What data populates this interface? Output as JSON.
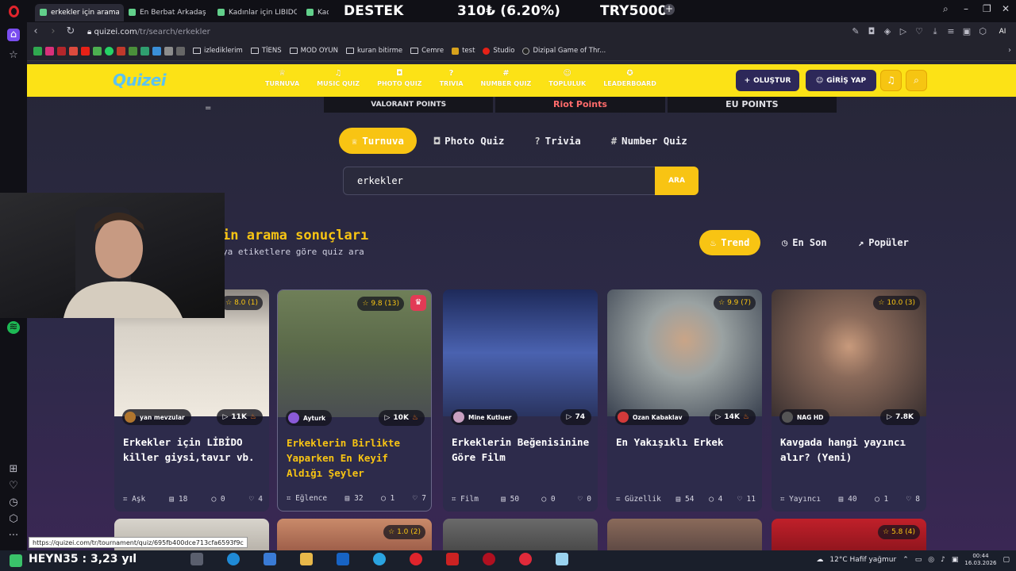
{
  "browser": {
    "tabs": [
      {
        "title": "erkekler için arama sonuç",
        "active": true
      },
      {
        "title": "En Berbat Arkadaş Tipi? -",
        "active": false
      },
      {
        "title": "Kadınlar için LİBİDO killer",
        "active": false
      },
      {
        "title": "Kadınım",
        "active": false
      }
    ],
    "promo_left": "DESTEK",
    "promo_mid": "310₺ (6.20%)",
    "promo_right": "TRY5000",
    "url_host": "quizei.com",
    "url_path": "/tr/search/erkekler",
    "ai_label": "AI",
    "bookmarks": [
      {
        "label": "izlediklerim",
        "type": "folder"
      },
      {
        "label": "TİENS",
        "type": "folder"
      },
      {
        "label": "MOD OYUN",
        "type": "folder"
      },
      {
        "label": "kuran bitirme",
        "type": "folder"
      },
      {
        "label": "Cemre",
        "type": "folder"
      },
      {
        "label": "test",
        "type": "site"
      },
      {
        "label": "Studio",
        "type": "site"
      },
      {
        "label": "Dizipal Game of Thr...",
        "type": "site"
      }
    ],
    "hover_url": "https://quizei.com/tr/tournament/quiz/695fb400dce713cfa6593f9c"
  },
  "site": {
    "logo": "Quizei",
    "menu": [
      {
        "label": "TURNUVA",
        "icon": "trophy-icon",
        "glyph": "♕"
      },
      {
        "label": "MUSIC QUIZ",
        "icon": "music-icon",
        "glyph": "♫"
      },
      {
        "label": "PHOTO QUIZ",
        "icon": "camera-icon",
        "glyph": "◘"
      },
      {
        "label": "TRIVIA",
        "icon": "question-icon",
        "glyph": "?"
      },
      {
        "label": "NUMBER QUIZ",
        "icon": "hash-icon",
        "glyph": "#"
      },
      {
        "label": "TOPLULUK",
        "icon": "users-icon",
        "glyph": "☺"
      },
      {
        "label": "LEADERBOARD",
        "icon": "award-icon",
        "glyph": "✪"
      }
    ],
    "create_label": "OLUŞTUR",
    "login_label": "GİRİŞ YAP",
    "ads": [
      "VALORANT POINTS",
      "Riot Points",
      "EU POINTS"
    ],
    "dash": "="
  },
  "search": {
    "type_tabs": [
      {
        "label": "Turnuva",
        "icon": "trophy-icon",
        "glyph": "♕",
        "active": true
      },
      {
        "label": "Photo Quiz",
        "icon": "camera-icon",
        "glyph": "◘",
        "active": false
      },
      {
        "label": "Trivia",
        "icon": "question-icon",
        "glyph": "?",
        "active": false
      },
      {
        "label": "Number Quiz",
        "icon": "hash-icon",
        "glyph": "#",
        "active": false
      }
    ],
    "query": "erkekler",
    "button_label": "ARA",
    "title_visible": "in arama sonuçları",
    "subtitle_visible": "ya etiketlere göre quiz ara",
    "sort": [
      {
        "label": "Trend",
        "icon": "flame-icon",
        "glyph": "♨",
        "active": true
      },
      {
        "label": "En Son",
        "icon": "clock-icon",
        "glyph": "◷",
        "active": false
      },
      {
        "label": "Popüler",
        "icon": "trending-icon",
        "glyph": "↗",
        "active": false
      }
    ]
  },
  "cards": [
    {
      "rating": "8.0 (1)",
      "author": "yan mevzular",
      "plays": "11K",
      "fire": true,
      "title": "Erkekler için LİBİDO killer giysi,tavır vb.",
      "category": "Aşk",
      "questions": "18",
      "comments": "0",
      "likes": "4",
      "img": "#c9c2b8",
      "av": "#b0752e"
    },
    {
      "rating": "9.8 (13)",
      "author": "Ayturk",
      "plays": "10K",
      "fire": true,
      "title": "Erkeklerin Birlikte Yaparken En Keyif Aldığı Şeyler",
      "category": "Eğlence",
      "questions": "32",
      "comments": "1",
      "likes": "7",
      "img": "#6b7a5c",
      "av": "#8a5ad8",
      "crown": true
    },
    {
      "rating": "",
      "author": "Mine Kutluer",
      "plays": "74",
      "fire": false,
      "title": "Erkeklerin Beğenisinine Göre Film",
      "category": "Film",
      "questions": "50",
      "comments": "0",
      "likes": "0",
      "img": "#3d4d8a",
      "av": "#c8a0c0"
    },
    {
      "rating": "9.9 (7)",
      "author": "Ozan Kabaklav",
      "plays": "14K",
      "fire": true,
      "title": "En Yakışıklı Erkek",
      "category": "Güzellik",
      "questions": "54",
      "comments": "4",
      "likes": "11",
      "img": "#aeb6b6",
      "av": "#d23a3a"
    },
    {
      "rating": "10.0 (3)",
      "author": "NAG HD",
      "plays": "7.8K",
      "fire": false,
      "title": "Kavgada hangi yayıncı alır? (Yeni)",
      "category": "Yayıncı",
      "questions": "40",
      "comments": "1",
      "likes": "8",
      "img": "#8a6a5a",
      "av": "#555"
    }
  ],
  "cards_row2": [
    {
      "rating": "",
      "img": "#e8e4dc"
    },
    {
      "rating": "1.0 (2)",
      "img": "#c98a6a"
    },
    {
      "rating": "",
      "img": "#5a5a5a"
    },
    {
      "rating": "",
      "img": "#7a5a4a"
    },
    {
      "rating": "5.8 (4)",
      "img": "#b2202a"
    }
  ],
  "taskbar": {
    "overlay_text": "HEYN35 : 3,23 yıl",
    "weather": "12°C  Hafif yağmur",
    "time": "00:44",
    "date": "16.03.2026"
  }
}
